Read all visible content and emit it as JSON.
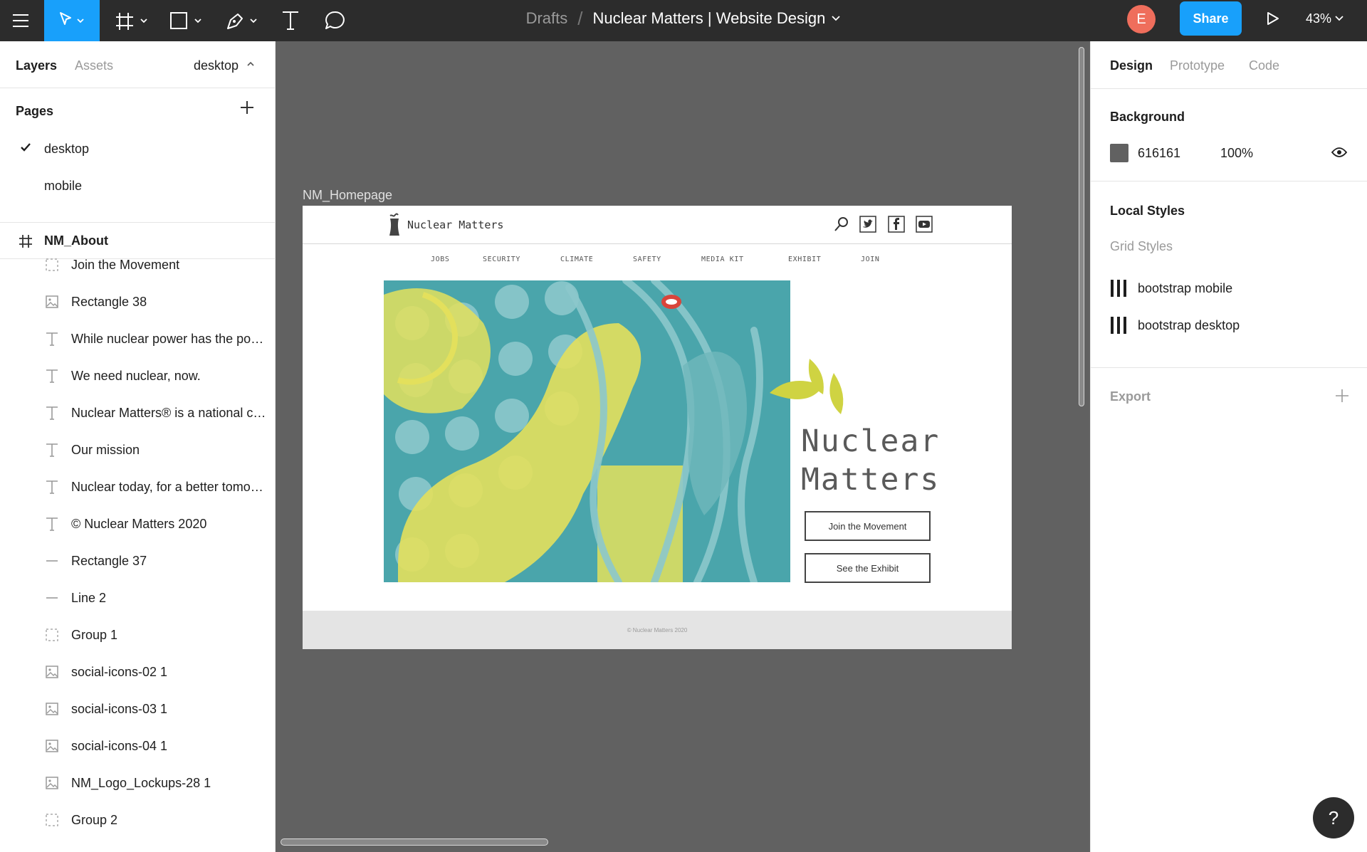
{
  "toolbar": {
    "doc_drafts": "Drafts",
    "doc_slash": "/",
    "doc_name": "Nuclear Matters | Website Design",
    "avatar_letter": "E",
    "share_label": "Share",
    "zoom_level": "43%"
  },
  "left_panel": {
    "tab_layers": "Layers",
    "tab_assets": "Assets",
    "page_selector": "desktop",
    "pages_header": "Pages",
    "pages": [
      {
        "label": "desktop",
        "selected": true
      },
      {
        "label": "mobile",
        "selected": false
      }
    ],
    "frame_name": "NM_About",
    "layers": [
      {
        "label": "Join the Movement",
        "icon": "group-icon"
      },
      {
        "label": "Rectangle 38",
        "icon": "image-icon"
      },
      {
        "label": "While nuclear power has the potential to help",
        "icon": "text-icon"
      },
      {
        "label": "We need nuclear, now.",
        "icon": "text-icon"
      },
      {
        "label": "Nuclear Matters® is a national campaign",
        "icon": "text-icon"
      },
      {
        "label": "Our mission",
        "icon": "text-icon"
      },
      {
        "label": "Nuclear today, for a better tomorrow",
        "icon": "text-icon"
      },
      {
        "label": "© Nuclear Matters 2020",
        "icon": "text-icon"
      },
      {
        "label": "Rectangle 37",
        "icon": "line-icon"
      },
      {
        "label": "Line 2",
        "icon": "line-icon"
      },
      {
        "label": "Group 1",
        "icon": "group-icon"
      },
      {
        "label": "social-icons-02 1",
        "icon": "image-icon"
      },
      {
        "label": "social-icons-03 1",
        "icon": "image-icon"
      },
      {
        "label": "social-icons-04 1",
        "icon": "image-icon"
      },
      {
        "label": "NM_Logo_Lockups-28 1",
        "icon": "image-icon"
      },
      {
        "label": "Group 2",
        "icon": "group-icon"
      }
    ]
  },
  "canvas": {
    "frame_label": "NM_Homepage",
    "site": {
      "brand": "Nuclear Matters",
      "nav": [
        "JOBS",
        "SECURITY",
        "CLIMATE",
        "SAFETY",
        "MEDIA KIT",
        "EXHIBIT",
        "JOIN"
      ],
      "title_line1": "Nuclear",
      "title_line2": "Matters",
      "btn_join": "Join the Movement",
      "btn_exhibit": "See the Exhibit",
      "footer": "© Nuclear Matters 2020"
    }
  },
  "right_panel": {
    "tab_design": "Design",
    "tab_prototype": "Prototype",
    "tab_code": "Code",
    "background_header": "Background",
    "background_hex": "616161",
    "background_opacity": "100%",
    "local_styles_header": "Local Styles",
    "grid_styles_label": "Grid Styles",
    "grid_styles": [
      "bootstrap mobile",
      "bootstrap desktop"
    ],
    "export_header": "Export"
  },
  "help_label": "?",
  "colors": {
    "accent": "#18a0fb",
    "toolbar_bg": "#2c2c2c",
    "canvas_bg": "#616161",
    "avatar": "#ef6e5c",
    "hero_teal": "#4aa5ab",
    "hero_yellow": "#e3e05c"
  }
}
